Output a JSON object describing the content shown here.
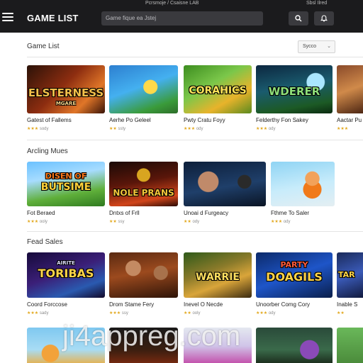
{
  "topbar": {
    "links_center": "Pcrsmoje / Csaisne LAB",
    "links_right": "Sbsl Ilred",
    "brand": "GAME LIST",
    "search_placeholder": "Game fique ea Jstej",
    "icons": [
      "menu-icon",
      "search-icon",
      "notifications-icon"
    ]
  },
  "section1": {
    "title": "Game List",
    "sort_label": "Sycco",
    "cards": [
      {
        "name": "Gatest of Fallems",
        "meta_stars": "★★★",
        "meta_text": "sody",
        "art": "ELSTERNESS",
        "art_sub": "MGARE"
      },
      {
        "name": "Aerhe Po Geleel",
        "meta_stars": "★★",
        "meta_text": "ssty",
        "art": "",
        "art_sub": ""
      },
      {
        "name": "Pwty Cratu Foyy",
        "meta_stars": "★★★",
        "meta_text": "ody",
        "art": "CORAHICS",
        "art_sub": ""
      },
      {
        "name": "Felderthy Fon Sakey",
        "meta_stars": "★★★",
        "meta_text": "ody",
        "art": "WDERER",
        "art_sub": ""
      },
      {
        "name": "Aactar Pu",
        "meta_stars": "★★★",
        "meta_text": "",
        "art": "",
        "art_sub": ""
      }
    ]
  },
  "section2": {
    "title": "Arcling Mues",
    "cards": [
      {
        "name": "Fot Beraed",
        "meta_stars": "★★★",
        "meta_text": "ooly",
        "art": "DISEN OF",
        "art_sub": "BUTSIME"
      },
      {
        "name": "Dntxs of Frll",
        "meta_stars": "★★",
        "meta_text": "ssy",
        "art": "NOLE PRANS",
        "art_sub": ""
      },
      {
        "name": "Unoai d Furgeacy",
        "meta_stars": "★★",
        "meta_text": "ody",
        "art": "",
        "art_sub": ""
      },
      {
        "name": "Fthme To Saler",
        "meta_stars": "★★★",
        "meta_text": "ody",
        "art": "",
        "art_sub": ""
      }
    ]
  },
  "section3": {
    "title": "Fead Sales",
    "cards": [
      {
        "name": "Coord Forccose",
        "meta_stars": "★★★",
        "meta_text": "sady",
        "art": "TORIBAS",
        "art_sub": "AIRITE"
      },
      {
        "name": "Drom Stame Fery",
        "meta_stars": "★★★",
        "meta_text": "ssy",
        "art": "",
        "art_sub": ""
      },
      {
        "name": "Inevel O Necde",
        "meta_stars": "★★",
        "meta_text": "ooly",
        "art": "WARRIE",
        "art_sub": ""
      },
      {
        "name": "Unoorber Comg Cory",
        "meta_stars": "★★★",
        "meta_text": "ody",
        "art": "DOAGILS",
        "art_sub": "PARTY"
      },
      {
        "name": "Inable S",
        "meta_stars": "★★",
        "meta_text": "",
        "art": "TAR",
        "art_sub": ""
      }
    ]
  },
  "watermark": "ji4appreg.com",
  "colors": {
    "topbar": "#1b1b1d",
    "search_bg": "#3a3a3e",
    "stars": "#e2a81e"
  }
}
